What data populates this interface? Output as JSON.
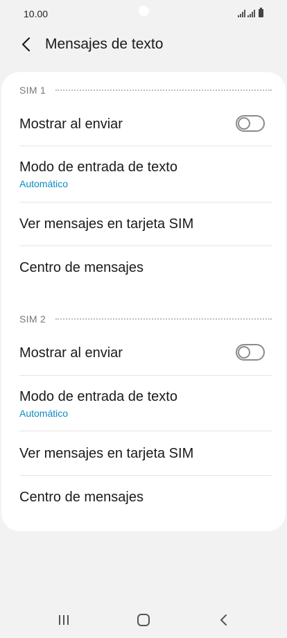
{
  "status_bar": {
    "time": "10.00"
  },
  "header": {
    "title": "Mensajes de texto"
  },
  "sim1": {
    "label": "SIM 1",
    "show_on_send": {
      "label": "Mostrar al enviar",
      "enabled": false
    },
    "input_mode": {
      "label": "Modo de entrada de texto",
      "value": "Automático"
    },
    "view_sim_messages": {
      "label": "Ver mensajes en tarjeta SIM"
    },
    "message_center": {
      "label": "Centro de mensajes"
    }
  },
  "sim2": {
    "label": "SIM 2",
    "show_on_send": {
      "label": "Mostrar al enviar",
      "enabled": false
    },
    "input_mode": {
      "label": "Modo de entrada de texto",
      "value": "Automático"
    },
    "view_sim_messages": {
      "label": "Ver mensajes en tarjeta SIM"
    },
    "message_center": {
      "label": "Centro de mensajes"
    }
  },
  "icons": {
    "back": "chevron-left-icon",
    "recents": "recent-apps-icon",
    "home": "home-icon",
    "nav_back": "nav-back-icon"
  },
  "colors": {
    "accent": "#0b8ac2",
    "background": "#f2f2f2",
    "card": "#ffffff"
  }
}
